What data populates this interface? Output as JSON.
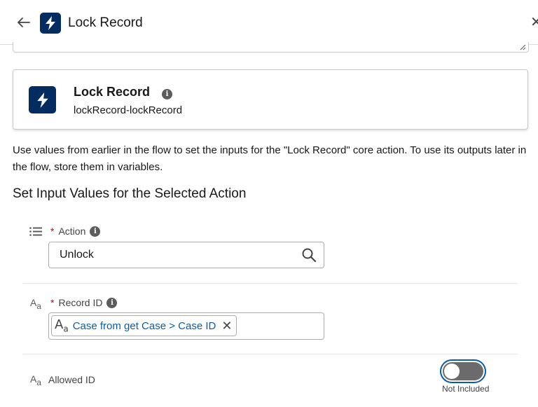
{
  "header": {
    "title": "Lock Record",
    "back_icon": "arrow-left-icon",
    "close_icon": "close-icon",
    "badge_icon": "lightning-icon",
    "badge_color": "#032d60"
  },
  "action_card": {
    "title": "Lock Record",
    "api_name": "lockRecord-lockRecord",
    "badge_icon": "lightning-icon",
    "info_icon": "info-icon"
  },
  "description": "Use values from earlier in the flow to set the inputs for the \"Lock Record\" core action. To use its outputs later in the flow, store them in variables.",
  "section_title": "Set Input Values for the Selected Action",
  "fields": {
    "action": {
      "type_icon": "picklist-icon",
      "required_mark": "*",
      "label": "Action",
      "value": "Unlock",
      "search_icon": "search-icon"
    },
    "record_id": {
      "type_icon": "text-type-icon",
      "type_glyph": "A",
      "type_glyph_sub": "a",
      "required_mark": "*",
      "label": "Record ID",
      "pill_text": "Case from get Case > Case ID",
      "pill_glyph": "A",
      "pill_glyph_sub": "a",
      "pill_remove_icon": "close-icon"
    },
    "allowed_id": {
      "type_icon": "text-type-icon",
      "type_glyph": "A",
      "type_glyph_sub": "a",
      "label": "Allowed ID",
      "toggle_label": "Not Included",
      "toggle_on": false
    }
  },
  "colors": {
    "accent": "#0b5cab",
    "required": "#ba0517",
    "brand": "#032d60"
  }
}
